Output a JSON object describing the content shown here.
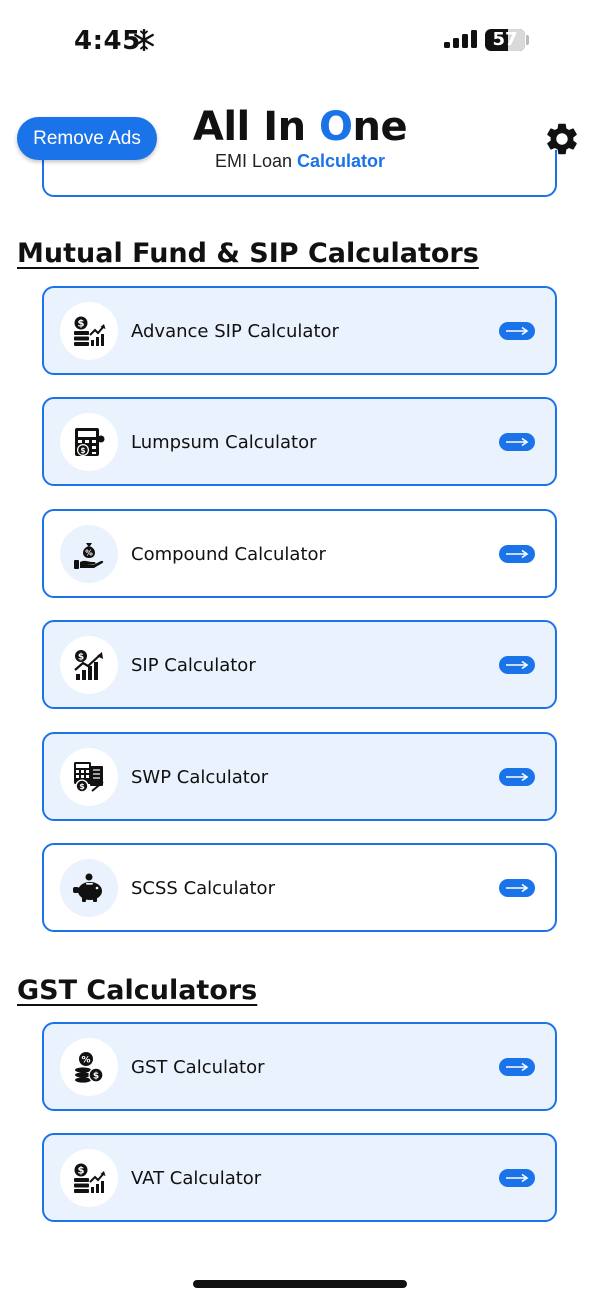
{
  "status_bar": {
    "time": "4:45",
    "battery": "57",
    "battery_level_percent": 57
  },
  "header": {
    "remove_ads_label": "Remove Ads",
    "title_part1": "All In ",
    "title_o": "O",
    "title_part2": "ne",
    "subtitle_part1": "EMI Loan ",
    "subtitle_part2": "Calculator",
    "accent_color": "#1a73e8"
  },
  "sections": [
    {
      "title": "Mutual Fund & SIP Calculators",
      "items": [
        {
          "label": "Advance SIP Calculator",
          "icon": "money-growth-icon"
        },
        {
          "label": "Lumpsum Calculator",
          "icon": "calculator-money-icon"
        },
        {
          "label": "Compound Calculator",
          "icon": "hand-money-bag-icon"
        },
        {
          "label": "SIP Calculator",
          "icon": "coin-chart-icon"
        },
        {
          "label": "SWP Calculator",
          "icon": "calculator-document-icon"
        },
        {
          "label": "SCSS Calculator",
          "icon": "piggy-bank-icon"
        }
      ]
    },
    {
      "title": "GST Calculators",
      "items": [
        {
          "label": "GST Calculator",
          "icon": "percent-coins-icon"
        },
        {
          "label": "VAT Calculator",
          "icon": "money-growth-icon"
        }
      ]
    }
  ]
}
